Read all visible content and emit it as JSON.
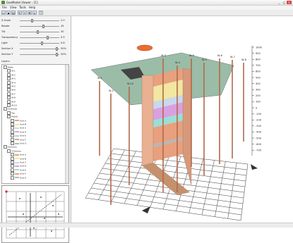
{
  "window": {
    "title": "GeoModel Viewer - [1]",
    "min": "_",
    "max": "□",
    "close": "×"
  },
  "menu": [
    "File",
    "View",
    "Tools",
    "Help"
  ],
  "toolbar": [
    "open",
    "save",
    "print",
    "rotate",
    "zoom",
    "pan",
    "reset",
    "help"
  ],
  "left": {
    "sliders": [
      {
        "label": "Z-Scale",
        "value": "2.0",
        "pos": 0.3
      },
      {
        "label": "Rotate",
        "value": "45",
        "pos": 0.6
      },
      {
        "label": "Tilt",
        "value": "30",
        "pos": 0.45
      },
      {
        "label": "Transparency",
        "value": "0.5",
        "pos": 0.7
      },
      {
        "label": "Light",
        "value": "0.8",
        "pos": 0.55
      },
      {
        "label": "Section X",
        "value": "50%",
        "pos": 0.95
      },
      {
        "label": "Section Y",
        "value": "50%",
        "pos": 0.95
      }
    ],
    "group_label": "Layers",
    "tree": [
      {
        "indent": 0,
        "checked": true,
        "label": "Wells",
        "color": ""
      },
      {
        "indent": 1,
        "checked": true,
        "label": "W-1",
        "color": ""
      },
      {
        "indent": 1,
        "checked": true,
        "label": "W-2",
        "color": ""
      },
      {
        "indent": 1,
        "checked": true,
        "label": "W-3",
        "color": ""
      },
      {
        "indent": 1,
        "checked": true,
        "label": "W-4",
        "color": ""
      },
      {
        "indent": 1,
        "checked": true,
        "label": "W-5",
        "color": ""
      },
      {
        "indent": 1,
        "checked": true,
        "label": "W-6",
        "color": ""
      },
      {
        "indent": 1,
        "checked": true,
        "label": "W-7",
        "color": ""
      },
      {
        "indent": 1,
        "checked": true,
        "label": "W-8",
        "color": ""
      },
      {
        "indent": 1,
        "checked": true,
        "label": "W-9",
        "color": ""
      },
      {
        "indent": 1,
        "checked": true,
        "label": "W-10",
        "color": ""
      },
      {
        "indent": 0,
        "checked": true,
        "label": "Surfaces",
        "color": ""
      },
      {
        "indent": 1,
        "checked": true,
        "label": "Top",
        "color": ""
      },
      {
        "indent": 1,
        "checked": true,
        "label": "Model",
        "color": ""
      },
      {
        "indent": 2,
        "checked": true,
        "label": "Unit A",
        "color": "#e8a07e"
      },
      {
        "indent": 2,
        "checked": true,
        "label": "Unit B",
        "color": "#f2e6a0"
      },
      {
        "indent": 2,
        "checked": true,
        "label": "Unit C",
        "color": "#c8d8f0"
      },
      {
        "indent": 2,
        "checked": true,
        "label": "Unit D",
        "color": "#d9a0e0"
      },
      {
        "indent": 2,
        "checked": true,
        "label": "Unit E",
        "color": "#9adfd6"
      },
      {
        "indent": 2,
        "checked": true,
        "label": "Unit F",
        "color": "#e8a07e"
      },
      {
        "indent": 2,
        "checked": true,
        "label": "Unit G",
        "color": "#b6b6b6"
      },
      {
        "indent": 0,
        "checked": true,
        "label": "Sections",
        "color": ""
      },
      {
        "indent": 1,
        "checked": true,
        "label": "X-Section",
        "color": ""
      },
      {
        "indent": 2,
        "checked": true,
        "label": "Unit A",
        "color": "#e8a07e"
      },
      {
        "indent": 2,
        "checked": true,
        "label": "Unit B",
        "color": "#f2e6a0"
      },
      {
        "indent": 2,
        "checked": true,
        "label": "Unit C",
        "color": "#c8d8f0"
      },
      {
        "indent": 2,
        "checked": true,
        "label": "Unit D",
        "color": "#d9a0e0"
      },
      {
        "indent": 2,
        "checked": true,
        "label": "Unit E",
        "color": "#9adfd6"
      },
      {
        "indent": 2,
        "checked": true,
        "label": "Unit F",
        "color": "#e8a07e"
      },
      {
        "indent": 2,
        "checked": true,
        "label": "Unit G",
        "color": "#b6b6b6"
      }
    ]
  },
  "view": {
    "depth_ticks": [
      "1000",
      "900",
      "800",
      "700",
      "600",
      "500",
      "400",
      "300",
      "200",
      "100",
      "0",
      "-100",
      "-200",
      "-300",
      "-400",
      "-500",
      "-600",
      "-700"
    ],
    "well_labels": [
      "W-1",
      "W-2",
      "W-3",
      "W-4",
      "W-5",
      "W-6",
      "W-7",
      "W-8",
      "W-9",
      "W-10"
    ]
  },
  "colors": {
    "surface": "#7aa58a",
    "unitA": "#e8a07e",
    "unitB": "#f2e6a0",
    "unitC": "#c8d8f0",
    "unitD": "#d9a0e0",
    "unitE": "#9adfd6",
    "grid": "#3a3a3a"
  }
}
